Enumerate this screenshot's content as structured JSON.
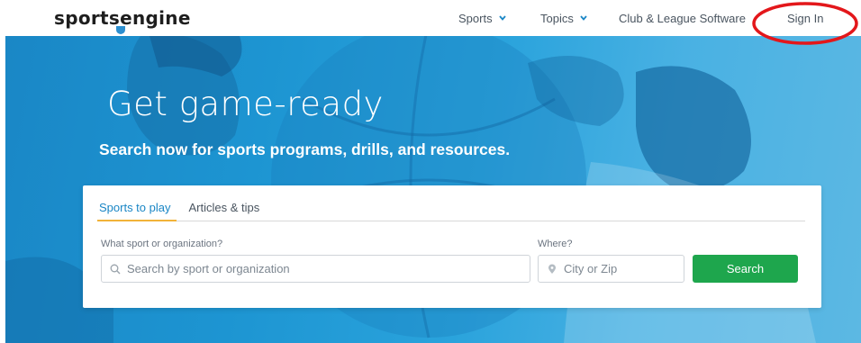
{
  "header": {
    "logo": "sportsengine",
    "nav": {
      "sports": "Sports",
      "topics": "Topics",
      "club": "Club & League Software",
      "signin": "Sign In"
    }
  },
  "hero": {
    "title": "Get game-ready",
    "subtitle": "Search now for sports programs, drills, and resources."
  },
  "search": {
    "tabs": [
      {
        "label": "Sports to play",
        "active": true
      },
      {
        "label": "Articles & tips",
        "active": false
      }
    ],
    "what": {
      "label": "What sport or organization?",
      "placeholder": "Search by sport or organization"
    },
    "where": {
      "label": "Where?",
      "placeholder": "City or Zip"
    },
    "button": "Search"
  },
  "colors": {
    "hero_blue": "#1d95d2",
    "accent_link": "#1a86c5",
    "tab_underline": "#f2b339",
    "button_green": "#1ea64d",
    "annotation_red": "#e3171b"
  },
  "icons": [
    "chevron-down-icon",
    "search-icon",
    "location-pin-icon",
    "logo-shield-icon"
  ]
}
